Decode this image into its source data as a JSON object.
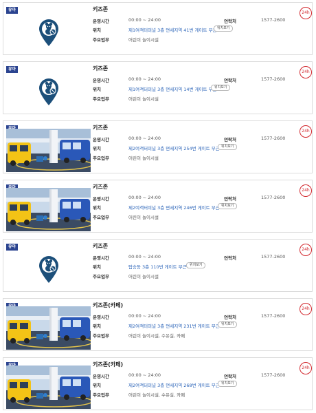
{
  "colors": {
    "badge": "#2b4490",
    "pin": "#1c4f7a",
    "link": "#2a63b8",
    "hours_ring": "#d2262c"
  },
  "labels": {
    "hours": "운영시간",
    "location": "위치",
    "duties": "주요업무",
    "contact": "연락처",
    "map_button": "위치보기"
  },
  "cards": [
    {
      "badge": "유아",
      "image": "location-pin-icon",
      "title": "키즈존",
      "hours": "00:00 ~ 24:00",
      "location": "제1여객터미널 3층 면세지역 41번 게이트 부근",
      "duties": "어린이 놀이시설",
      "contact": "1577-2600",
      "badge_24h": "24h"
    },
    {
      "badge": "유아",
      "image": "location-pin-icon",
      "title": "키즈존",
      "hours": "00:00 ~ 24:00",
      "location": "제1여객터미널 3층 면세지역 14번 게이트 부근",
      "duties": "어린이 놀이시설",
      "contact": "1577-2600",
      "badge_24h": "24h"
    },
    {
      "badge": "유아",
      "image": "kidszone-photo",
      "title": "키즈존",
      "hours": "00:00 ~ 24:00",
      "location": "제2여객터미널 3층 면세지역 254번 게이트 부근",
      "duties": "어린이 놀이시설",
      "contact": "1577-2600",
      "badge_24h": "24h"
    },
    {
      "badge": "유아",
      "image": "kidszone-photo",
      "title": "키즈존",
      "hours": "00:00 ~ 24:00",
      "location": "제2여객터미널 3층 면세지역 246번 게이트 부근",
      "duties": "어린이 놀이시설",
      "contact": "1577-2600",
      "badge_24h": "24h"
    },
    {
      "badge": "유아",
      "image": "location-pin-icon",
      "title": "키즈존",
      "hours": "00:00 ~ 24:00",
      "location": "탑승동 3층 110번 게이트 부근",
      "duties": "어린이 놀이시설",
      "contact": "1577-2600",
      "badge_24h": "24h"
    },
    {
      "badge": "유아",
      "image": "kidszone-photo",
      "title": "키즈존(카페)",
      "hours": "00:00 ~ 24:00",
      "location": "제2여객터미널 3층 면세지역 231번 게이트 부근",
      "duties": "어린이 놀이시설, 수유실, 카페",
      "contact": "1577-2600",
      "badge_24h": "24h"
    },
    {
      "badge": "유아",
      "image": "kidszone-photo",
      "title": "키즈존(카페)",
      "hours": "00:00 ~ 24:00",
      "location": "제2여객터미널 3층 면세지역 268번 게이트 부근",
      "duties": "어린이 놀이시설, 수유실, 카페",
      "contact": "1577-2600",
      "badge_24h": "24h"
    }
  ]
}
